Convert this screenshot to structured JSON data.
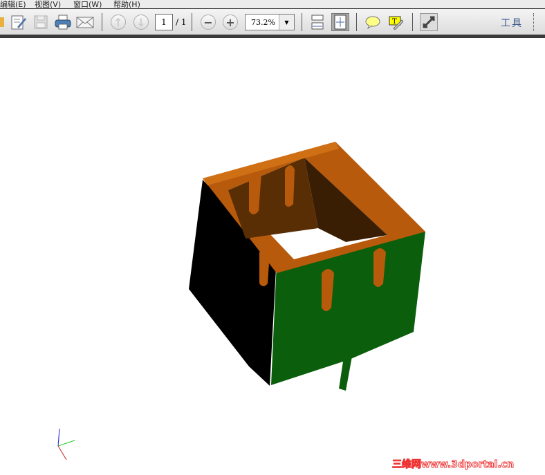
{
  "menu": {
    "items": [
      {
        "label": "编辑(E)"
      },
      {
        "label": "视图(V)"
      },
      {
        "label": "窗口(W)"
      },
      {
        "label": "帮助(H)"
      }
    ]
  },
  "toolbar": {
    "icons": [
      "edit-icon",
      "save-icon",
      "print-icon",
      "email-icon",
      "previous-page-icon",
      "next-page-icon",
      "zoom-out-icon",
      "zoom-in-icon",
      "fit-width-icon",
      "fit-page-icon",
      "comment-icon",
      "text-edit-icon",
      "full-screen-icon"
    ],
    "page_current": "1",
    "page_total": "/ 1",
    "zoom": "73.2%",
    "tools_label": "工具"
  },
  "viewer": {
    "model_colors": {
      "top": "#b85a0c",
      "front": "#0b5e0b",
      "side": "#000000",
      "inner": "#5a2e05"
    }
  },
  "watermark": "三维网www.3dportal.cn"
}
